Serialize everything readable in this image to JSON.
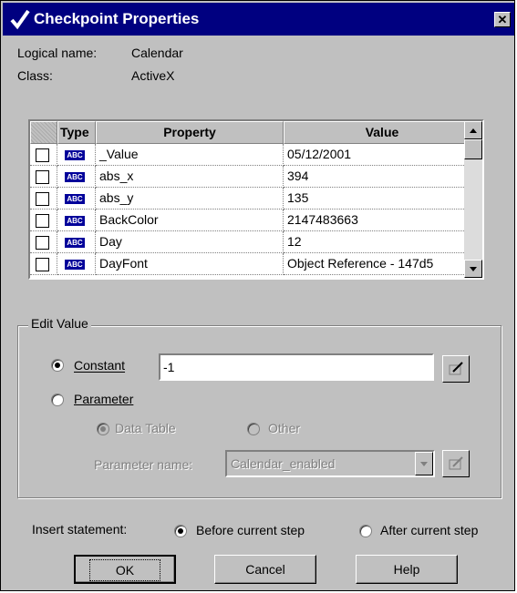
{
  "window": {
    "title": "Checkpoint Properties",
    "close_glyph": "✕"
  },
  "info": {
    "logical_name_label": "Logical name:",
    "logical_name_value": "Calendar",
    "class_label": "Class:",
    "class_value": "ActiveX"
  },
  "grid": {
    "headers": {
      "type": "Type",
      "property": "Property",
      "value": "Value"
    },
    "type_badge": "ABC",
    "rows": [
      {
        "property": "_Value",
        "value": "05/12/2001",
        "checked": false
      },
      {
        "property": "abs_x",
        "value": "394",
        "checked": false
      },
      {
        "property": "abs_y",
        "value": "135",
        "checked": false
      },
      {
        "property": "BackColor",
        "value": "2147483663",
        "checked": false
      },
      {
        "property": "Day",
        "value": "12",
        "checked": false
      },
      {
        "property": "DayFont",
        "value": "Object Reference - 147d5",
        "checked": false
      }
    ]
  },
  "edit_value": {
    "legend": "Edit Value",
    "constant_label": "Constant",
    "constant_value": "-1",
    "constant_selected": true,
    "parameter_label": "Parameter",
    "data_table_label": "Data Table",
    "other_label": "Other",
    "parameter_name_label": "Parameter name:",
    "parameter_name_value": "Calendar_enabled"
  },
  "insert": {
    "label": "Insert statement:",
    "before_label": "Before current step",
    "after_label": "After current step",
    "selected": "before"
  },
  "buttons": {
    "ok": "OK",
    "cancel": "Cancel",
    "help": "Help"
  }
}
